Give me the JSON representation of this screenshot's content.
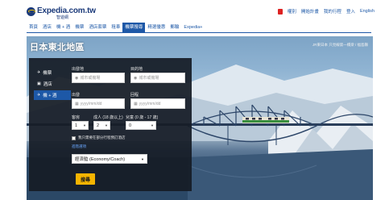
{
  "brand": {
    "name": "Expedia.com.tw",
    "sub": "智遊網"
  },
  "utility": {
    "links": [
      "權別",
      "開始計畫",
      "我的行程",
      "登入",
      "English"
    ]
  },
  "nav": {
    "items": [
      "首頁",
      "酒店",
      "機 + 酒",
      "機票",
      "酒店套票",
      "租車",
      "機票搜尋",
      "精選優惠",
      "郵輪",
      "Expedia+"
    ],
    "active_index": 6
  },
  "hero": {
    "title": "日本東北地區",
    "caption": "JR東日本 只見線第一橋梁 / 福島縣"
  },
  "search": {
    "tabs": [
      {
        "icon": "plane-icon",
        "label": "機票",
        "active": false
      },
      {
        "icon": "hotel-icon",
        "label": "酒店",
        "active": false
      },
      {
        "icon": "package-icon",
        "label": "機 + 酒",
        "active": true
      }
    ],
    "from_label": "出發地",
    "from_placeholder": "城市或機場",
    "to_label": "目的地",
    "to_placeholder": "城市或機場",
    "depart_label": "出發",
    "depart_placeholder": "yyyy/mm/dd",
    "return_label": "回程",
    "return_placeholder": "yyyy/mm/dd",
    "rooms_label": "客房",
    "adults_label": "成人 (18 歲以上)",
    "children_label": "兒童 (0 歲 - 17 歲)",
    "rooms_value": "1",
    "adults_value": "2",
    "children_value": "0",
    "partial_hotel_label": "我只需要在部分行程預訂酒店",
    "advanced_link": "進階選項",
    "cabin_value": "經濟艙 (Economy/Coach)",
    "submit_label": "搜尋"
  }
}
